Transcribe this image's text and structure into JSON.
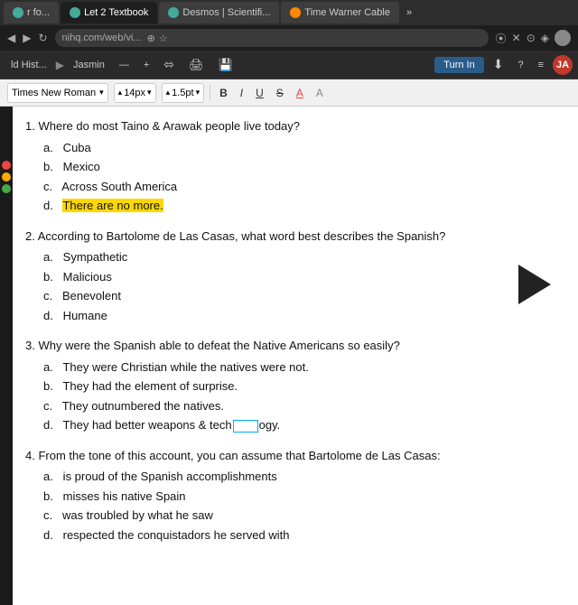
{
  "browser": {
    "url": "nihq.com/web/vi...",
    "tabs": [
      {
        "id": "tab1",
        "label": "r fo...",
        "icon_color": "#4a9"
      },
      {
        "id": "tab2",
        "label": "Let 2 Textbook",
        "icon_color": "#4a9",
        "active": true
      },
      {
        "id": "tab3",
        "label": "Desmos | Scientifi...",
        "icon_color": "#4a9"
      },
      {
        "id": "tab4",
        "label": "Time Warner Cable",
        "icon_color": "#f80"
      }
    ],
    "tab_more_label": "»"
  },
  "toolbar": {
    "hist_label": "ld Hist...",
    "breadcrumb_arrow": "▶",
    "doc_name": "Jasmin",
    "dash": "—",
    "plus": "+",
    "share_icon": "⬄",
    "print_icon": "🖨",
    "save_icon": "💾",
    "turn_in_label": "Turn In",
    "download_icon": "⬇",
    "help_icon": "?",
    "menu_icon": "≡",
    "avatar_label": "JA"
  },
  "font_toolbar": {
    "font_name": "Times New Roman",
    "font_size": "14px",
    "line_spacing": "1.5pt",
    "bold_label": "B",
    "italic_label": "I",
    "underline_label": "U",
    "strikethrough_label": "S",
    "color_a_label": "A",
    "color_a2_label": "A"
  },
  "document": {
    "questions": [
      {
        "num": "1.",
        "text": "Where do most Taino & Arawak people live today?",
        "options": [
          {
            "letter": "a.",
            "text": "Cuba",
            "highlighted": false
          },
          {
            "letter": "b.",
            "text": "Mexico",
            "highlighted": false
          },
          {
            "letter": "c.",
            "text": "Across South America",
            "highlighted": false
          },
          {
            "letter": "d.",
            "text": "There are no more.",
            "highlighted": true
          }
        ]
      },
      {
        "num": "2.",
        "text": "According to Bartolome de Las Casas, what word best describes the Spanish?",
        "options": [
          {
            "letter": "a.",
            "text": "Sympathetic",
            "highlighted": false
          },
          {
            "letter": "b.",
            "text": "Malicious",
            "highlighted": false
          },
          {
            "letter": "c.",
            "text": "Benevolent",
            "highlighted": false
          },
          {
            "letter": "d.",
            "text": "Humane",
            "highlighted": false
          }
        ]
      },
      {
        "num": "3.",
        "text": "Why were the Spanish able to defeat the Native Americans so easily?",
        "options": [
          {
            "letter": "a.",
            "text": "They were Christian while the natives were not.",
            "highlighted": false
          },
          {
            "letter": "b.",
            "text": "They had the element of surprise.",
            "highlighted": false
          },
          {
            "letter": "c.",
            "text": "They outnumbered the natives.",
            "highlighted": false
          },
          {
            "letter": "d.",
            "text": "They had better weapons & technology.",
            "highlighted": false,
            "cursor": true
          }
        ]
      },
      {
        "num": "4.",
        "text": "From the tone of this account, you can assume that Bartolome de Las Casas:",
        "options": [
          {
            "letter": "a.",
            "text": "is proud of the Spanish accomplishments",
            "highlighted": false
          },
          {
            "letter": "b.",
            "text": "misses his native Spain",
            "highlighted": false
          },
          {
            "letter": "c.",
            "text": "was troubled by what he saw",
            "highlighted": false
          },
          {
            "letter": "d.",
            "text": "respected the conquistadors he served with",
            "highlighted": false
          }
        ]
      }
    ]
  },
  "sidebar": {
    "dots": [
      {
        "color": "#e44"
      },
      {
        "color": "#fa0"
      },
      {
        "color": "#4a4"
      }
    ]
  }
}
